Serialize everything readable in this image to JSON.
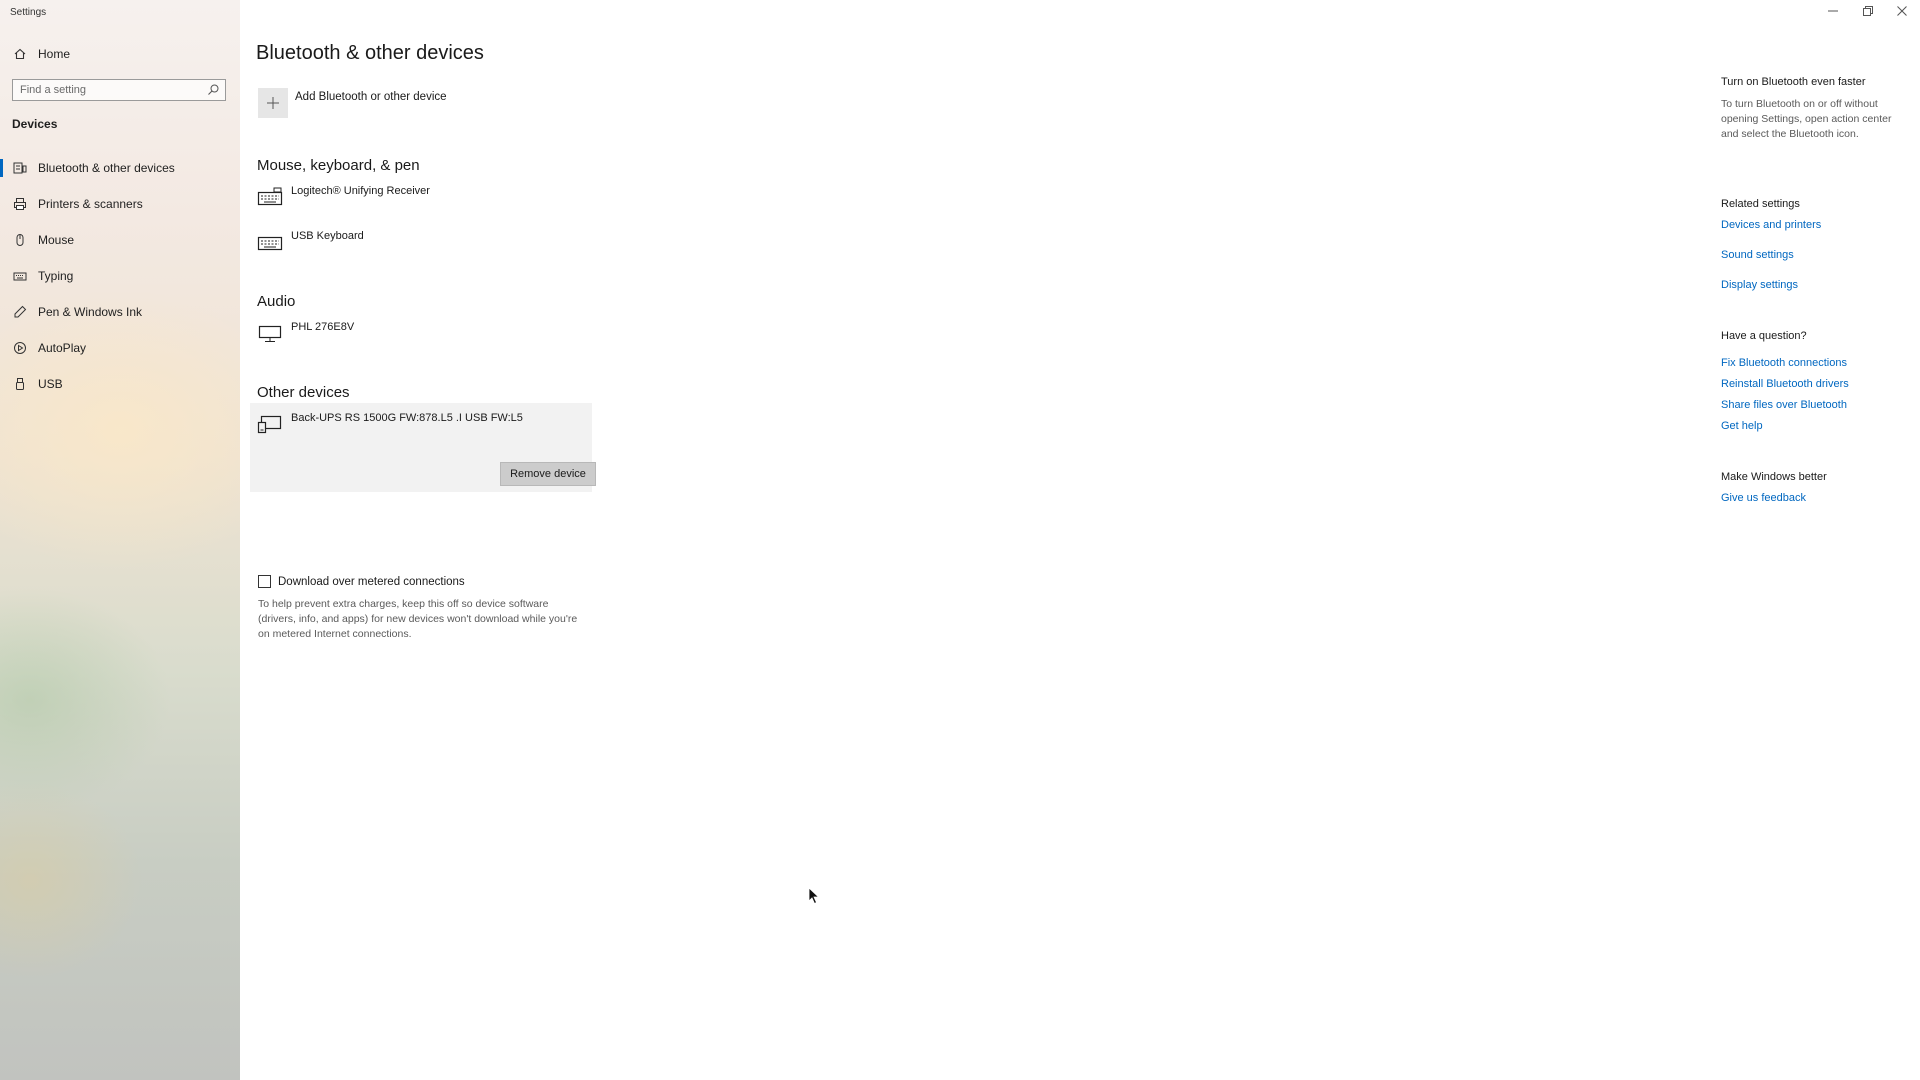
{
  "window": {
    "title": "Settings",
    "controls": [
      "minimize-icon",
      "restore-icon",
      "close-icon"
    ]
  },
  "sidebar": {
    "home_label": "Home",
    "search": {
      "placeholder": "Find a setting",
      "value": ""
    },
    "section": "Devices",
    "items": [
      {
        "label": "Bluetooth & other devices",
        "icon": "bluetooth-devices-icon",
        "active": true
      },
      {
        "label": "Printers & scanners",
        "icon": "printer-icon",
        "active": false
      },
      {
        "label": "Mouse",
        "icon": "mouse-icon",
        "active": false
      },
      {
        "label": "Typing",
        "icon": "keyboard-icon",
        "active": false
      },
      {
        "label": "Pen & Windows Ink",
        "icon": "pen-icon",
        "active": false
      },
      {
        "label": "AutoPlay",
        "icon": "autoplay-icon",
        "active": false
      },
      {
        "label": "USB",
        "icon": "usb-icon",
        "active": false
      }
    ]
  },
  "main": {
    "title": "Bluetooth & other devices",
    "add_device_label": "Add Bluetooth or other device",
    "groups": {
      "input": {
        "title": "Mouse, keyboard, & pen",
        "devices": [
          {
            "name": "Logitech® Unifying Receiver",
            "icon": "keyboard-icon"
          },
          {
            "name": "USB Keyboard",
            "icon": "keyboard-icon"
          }
        ]
      },
      "audio": {
        "title": "Audio",
        "devices": [
          {
            "name": "PHL 276E8V",
            "icon": "monitor-icon"
          }
        ]
      },
      "other": {
        "title": "Other devices",
        "devices": [
          {
            "name": "Back-UPS RS 1500G FW:878.L5 .I USB FW:L5",
            "icon": "device-icon",
            "selected": true
          }
        ],
        "remove_label": "Remove device"
      }
    },
    "metered": {
      "label": "Download over metered connections",
      "checked": false,
      "description": "To help prevent extra charges, keep this off so device software (drivers, info, and apps) for new devices won't download while you're on metered Internet connections."
    }
  },
  "right_pane": {
    "bluetooth_tip": {
      "title": "Turn on Bluetooth even faster",
      "text": "To turn Bluetooth on or off without opening Settings, open action center and select the Bluetooth icon."
    },
    "related": {
      "title": "Related settings",
      "links": [
        "Devices and printers",
        "Sound settings",
        "Display settings"
      ]
    },
    "question": {
      "title": "Have a question?",
      "links": [
        "Fix Bluetooth connections",
        "Reinstall Bluetooth drivers",
        "Share files over Bluetooth",
        "Get help"
      ]
    },
    "feedback": {
      "title": "Make Windows better",
      "link": "Give us feedback"
    }
  },
  "colors": {
    "accent": "#0067c0",
    "remove_button_bg": "#cccccc",
    "selected_device_bg": "#f2f2f2"
  }
}
